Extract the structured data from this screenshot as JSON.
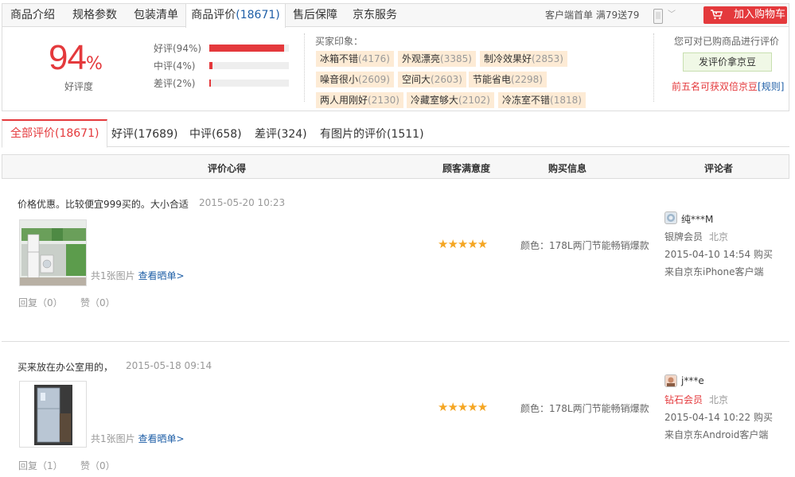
{
  "tabs": [
    {
      "label": "商品介绍"
    },
    {
      "label": "规格参数"
    },
    {
      "label": "包装清单"
    },
    {
      "label": "商品评价",
      "count": "(18671)"
    },
    {
      "label": "售后保障"
    },
    {
      "label": "京东服务"
    }
  ],
  "promo": "客户端首单 满79送79",
  "cart_button": "加入购物车",
  "rating": {
    "percent": "94",
    "percent_sign": "%",
    "label": "好评度",
    "bars": [
      {
        "label": "好评(94%)",
        "value": 94
      },
      {
        "label": "中评(4%)",
        "value": 4
      },
      {
        "label": "差评(2%)",
        "value": 2
      }
    ]
  },
  "impressions": {
    "title": "买家印象：",
    "tags": [
      {
        "name": "冰箱不错",
        "count": "(4176)"
      },
      {
        "name": "外观漂亮",
        "count": "(3385)"
      },
      {
        "name": "制冷效果好",
        "count": "(2853)"
      },
      {
        "name": "噪音很小",
        "count": "(2609)"
      },
      {
        "name": "空间大",
        "count": "(2603)"
      },
      {
        "name": "节能省电",
        "count": "(2298)"
      },
      {
        "name": "两人用刚好",
        "count": "(2130)"
      },
      {
        "name": "冷藏室够大",
        "count": "(2102)"
      },
      {
        "name": "冷冻室不错",
        "count": "(1818)"
      }
    ]
  },
  "review_cta": {
    "hint": "您可对已购商品进行评价",
    "button": "发评价拿京豆",
    "bonus": "前五名可获双倍京豆",
    "rule_open": "[",
    "rule": "规则",
    "rule_close": "]"
  },
  "filters": [
    {
      "label": "全部评价(18671)"
    },
    {
      "label": "好评(17689)"
    },
    {
      "label": "中评(658)"
    },
    {
      "label": "差评(324)"
    },
    {
      "label": "有图片的评价(1511)"
    }
  ],
  "table_header": {
    "content": "评价心得",
    "satisfaction": "顾客满意度",
    "purchase": "购买信息",
    "reviewer": "评论者"
  },
  "reviews": [
    {
      "content": "价格优惠。比较便宜999买的。大小合适",
      "date": "2015-05-20 10:23",
      "pics_text": "共1张图片",
      "pics_link": "查看晒单>",
      "reply": "回复（0）",
      "like": "赞（0）",
      "stars": 5,
      "stars_text": "★★★★★",
      "color": "颜色：178L两门节能畅销爆款",
      "user": "纯***M",
      "level": "银牌会员",
      "location": "北京",
      "buy_time": "2015-04-10 14:54 购买",
      "source": "来自京东iPhone客户端"
    },
    {
      "content": "买来放在办公室用的，",
      "date": "2015-05-18 09:14",
      "pics_text": "共1张图片",
      "pics_link": "查看晒单>",
      "reply": "回复（1）",
      "like": "赞（0）",
      "stars": 5,
      "stars_text": "★★★★★",
      "color": "颜色：178L两门节能畅销爆款",
      "user": "j***e",
      "level": "钻石会员",
      "location": "北京",
      "buy_time": "2015-04-14 10:22 购买",
      "source": "来自京东Android客户端"
    }
  ],
  "colors": {
    "accent_red": "#e4393c",
    "link_blue": "#1f5fa7",
    "tag_bg": "#fdebd5",
    "star": "#f5a623"
  }
}
